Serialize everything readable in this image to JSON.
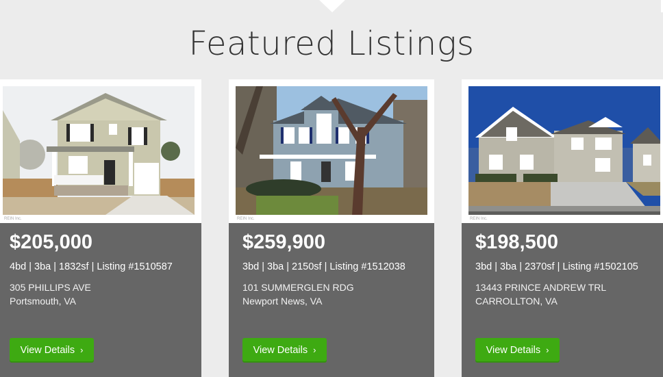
{
  "section": {
    "title": "Featured Listings"
  },
  "listings": [
    {
      "price": "$205,000",
      "specs": "4bd | 3ba | 1832sf | Listing #1510587",
      "address_line1": "305 PHILLIPS AVE",
      "address_line2": "Portsmouth, VA",
      "button_label": "View Details",
      "button_icon": "chevron-right-icon"
    },
    {
      "price": "$259,900",
      "specs": "3bd | 3ba | 2150sf | Listing #1512038",
      "address_line1": "101 SUMMERGLEN RDG",
      "address_line2": "Newport News, VA",
      "button_label": "View Details",
      "button_icon": "chevron-right-icon"
    },
    {
      "price": "$198,500",
      "specs": "3bd | 3ba | 2370sf | Listing #1502105",
      "address_line1": "13443 PRINCE ANDREW TRL",
      "address_line2": "CARROLLTON, VA",
      "button_label": "View Details",
      "button_icon": "chevron-right-icon"
    }
  ],
  "colors": {
    "page_background": "#ececec",
    "card_background": "#666666",
    "button_green": "#3eaa12",
    "title_text": "#333333"
  }
}
